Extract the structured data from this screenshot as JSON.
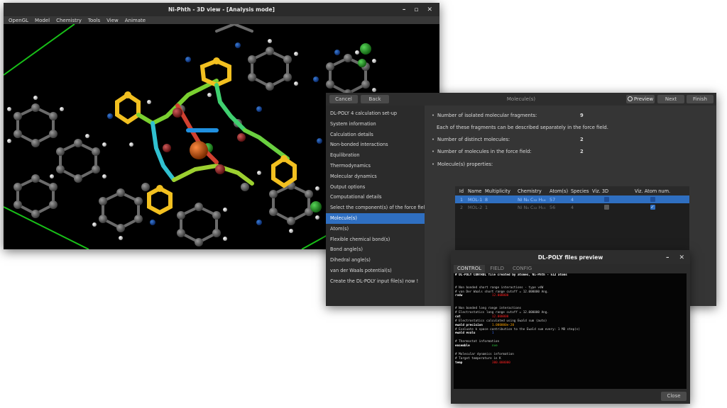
{
  "main_window": {
    "title": "Ni-Phth - 3D view - [Analysis mode]",
    "minimize": "–",
    "maximize": "▫",
    "close": "✕",
    "menu": [
      "OpenGL",
      "Model",
      "Chemistry",
      "Tools",
      "View",
      "Animate"
    ]
  },
  "wizard": {
    "title": "Molecule(s)",
    "cancel": "Cancel",
    "back": "Back",
    "preview": "Preview",
    "next": "Next",
    "finish": "Finish",
    "steps": [
      "DL-POLY 4 calculation set-up",
      "System information",
      "Calculation details",
      "Non-bonded interactions",
      "Equilibration",
      "Thermodynamics",
      "Molecular dynamics",
      "Output options",
      "Computational details",
      "Select the component(s) of the force field",
      "Molecule(s)",
      "Atom(s)",
      "Flexible chemical bond(s)",
      "Bond angle(s)",
      "Dihedral angle(s)",
      "van der Waals potential(s)",
      "Create the DL-POLY input file(s) now !"
    ],
    "active_step": 10,
    "info": {
      "frag_label": "Number of isolated molecular fragments:",
      "frag_value": "9",
      "frag_note": "Each of these fragments can be described separately in the force field.",
      "distinct_label": "Number of distinct molecules:",
      "distinct_value": "2",
      "ff_label": "Number of molecules in the force field:",
      "ff_value": "2",
      "props_label": "Molecule(s) properties:"
    },
    "table": {
      "headers": [
        "Id",
        "Name",
        "Multiplicity",
        "Chemistry",
        "Atom(s)",
        "Species",
        "Viz. 3D",
        "Viz. Atom num."
      ],
      "rows": [
        {
          "id": "1",
          "name": "MOL-1",
          "mult": "8",
          "chem": "Ni N₈ C₃₂ H₁₆",
          "atoms": "57",
          "species": "4"
        },
        {
          "id": "2",
          "name": "MOL-2",
          "mult": "1",
          "chem": "Ni N₈ C₃₂ H₁₅",
          "atoms": "56",
          "species": "4"
        }
      ]
    }
  },
  "preview_window": {
    "title": "DL-POLY files preview",
    "minimize": "–",
    "close": "✕",
    "tabs": [
      "CONTROL",
      "FIELD",
      "CONFIG"
    ],
    "close_button": "Close",
    "lines": [
      {
        "t": "# DL-POLY CONTROL file created by atomes, Ni-Phth - 512 atoms",
        "k": "",
        "v": "",
        "c": "#ffffff",
        "bold": true
      },
      {
        "t": "",
        "k": "",
        "v": "",
        "c": ""
      },
      {
        "t": "",
        "k": "",
        "v": "",
        "c": ""
      },
      {
        "t": "# Non bonded short range interactions - type vdW",
        "k": "",
        "v": "",
        "c": ""
      },
      {
        "t": "# van Der Waals short range cutoff = 12.000000 Ang.",
        "k": "",
        "v": "",
        "c": ""
      },
      {
        "t": "",
        "k": "rvdw",
        "v": "12.000000",
        "c": "#ff2020"
      },
      {
        "t": "",
        "k": "",
        "v": "",
        "c": ""
      },
      {
        "t": "",
        "k": "",
        "v": "",
        "c": ""
      },
      {
        "t": "# Non bonded long range interactions",
        "k": "",
        "v": "",
        "c": ""
      },
      {
        "t": "# Electrostatics long range cutoff = 12.000000 Ang.",
        "k": "",
        "v": "",
        "c": ""
      },
      {
        "t": "",
        "k": "cut",
        "v": "12.000000",
        "c": "#ff2020"
      },
      {
        "t": "# Electrostatics calculated using Ewald sum (auto)",
        "k": "",
        "v": "",
        "c": ""
      },
      {
        "t": "",
        "k": "ewald precision",
        "v": "1.000000e-20",
        "c": "#ffa500"
      },
      {
        "t": "# Evaluate k space contribution to the Ewald sum every: 1 MD step(s)",
        "k": "",
        "v": "",
        "c": ""
      },
      {
        "t": "",
        "k": "ewald evalu",
        "v": "1",
        "c": "#3a6fff"
      },
      {
        "t": "",
        "k": "",
        "v": "",
        "c": ""
      },
      {
        "t": "# Thermostat information",
        "k": "",
        "v": "",
        "c": ""
      },
      {
        "t": "",
        "k": "ensemble",
        "v": "nve",
        "c": "#2ecc40"
      },
      {
        "t": "",
        "k": "",
        "v": "",
        "c": ""
      },
      {
        "t": "# Molecular dynamics information",
        "k": "",
        "v": "",
        "c": ""
      },
      {
        "t": "# Target temperature in K",
        "k": "",
        "v": "",
        "c": ""
      },
      {
        "t": "",
        "k": "temp",
        "v": "300.000000",
        "c": "#ff2020"
      }
    ]
  },
  "colors": {
    "accent": "#2f6fc1",
    "checkbox_on": "#2f6fc1"
  }
}
